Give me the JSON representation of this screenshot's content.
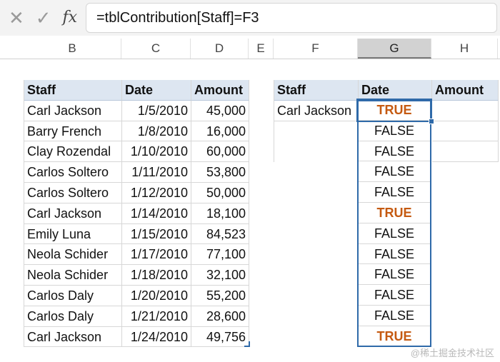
{
  "formula_bar": {
    "cancel_icon": "✕",
    "enter_icon": "✓",
    "fx_label": "fx",
    "formula": "=tblContribution[Staff]=F3"
  },
  "columns": [
    {
      "label": "B"
    },
    {
      "label": "C"
    },
    {
      "label": "D"
    },
    {
      "label": "E"
    },
    {
      "label": "F"
    },
    {
      "label": "G",
      "selected": true
    },
    {
      "label": "H"
    }
  ],
  "left_table": {
    "headers": [
      "Staff",
      "Date",
      "Amount"
    ],
    "rows": [
      [
        "Carl Jackson",
        "1/5/2010",
        "45,000"
      ],
      [
        "Barry French",
        "1/8/2010",
        "16,000"
      ],
      [
        "Clay Rozendal",
        "1/10/2010",
        "60,000"
      ],
      [
        "Carlos Soltero",
        "1/11/2010",
        "53,800"
      ],
      [
        "Carlos Soltero",
        "1/12/2010",
        "50,000"
      ],
      [
        "Carl Jackson",
        "1/14/2010",
        "18,100"
      ],
      [
        "Emily Luna",
        "1/15/2010",
        "84,523"
      ],
      [
        "Neola Schider",
        "1/17/2010",
        "77,100"
      ],
      [
        "Neola Schider",
        "1/18/2010",
        "32,100"
      ],
      [
        "Carlos Daly",
        "1/20/2010",
        "55,200"
      ],
      [
        "Carlos Daly",
        "1/21/2010",
        "28,600"
      ],
      [
        "Carl Jackson",
        "1/24/2010",
        "49,756"
      ]
    ]
  },
  "right_table": {
    "headers": [
      "Staff",
      "Date",
      "Amount"
    ],
    "criteria_staff": "Carl Jackson"
  },
  "results": [
    "TRUE",
    "FALSE",
    "FALSE",
    "FALSE",
    "FALSE",
    "TRUE",
    "FALSE",
    "FALSE",
    "FALSE",
    "FALSE",
    "FALSE",
    "TRUE"
  ],
  "watermark": "@稀土掘金技术社区",
  "colors": {
    "true_text": "#c55a11",
    "header_fill": "#dde6f1",
    "selection": "#2f6aa9"
  }
}
